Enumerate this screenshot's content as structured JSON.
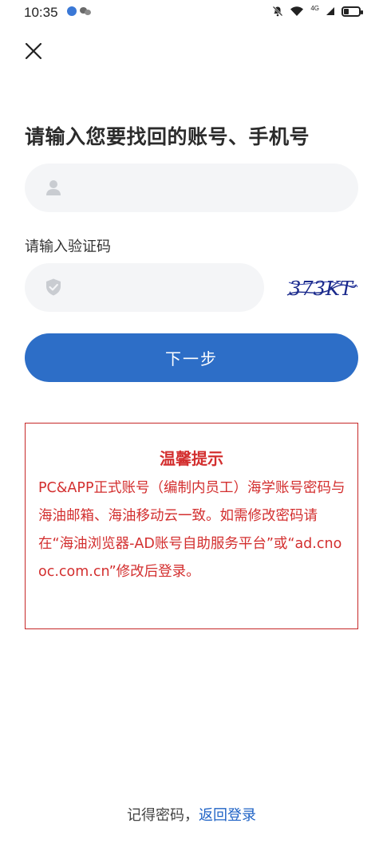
{
  "status_bar": {
    "time": "10:35",
    "network_label": "4G",
    "battery_level": 0.35
  },
  "page": {
    "title": "请输入您要找回的账号、手机号"
  },
  "account_field": {
    "value": "",
    "placeholder": "",
    "icon": "user-icon"
  },
  "captcha": {
    "label": "请输入验证码",
    "value": "",
    "placeholder": "",
    "icon": "shield-icon",
    "image_text": "373KT"
  },
  "buttons": {
    "next_label": "下一步"
  },
  "notice": {
    "title": "温馨提示",
    "body": "PC&APP正式账号（编制内员工）海学账号密码与海油邮箱、海油移动云一致。如需修改密码请在“海油浏览器-AD账号自助服务平台”或“ad.cnooc.com.cn”修改后登录。"
  },
  "footer": {
    "remember_text": "记得密码，",
    "back_link": "返回登录"
  },
  "colors": {
    "accent": "#2d6ec7",
    "notice_red": "#d32f2f",
    "input_bg": "#f4f5f7"
  }
}
